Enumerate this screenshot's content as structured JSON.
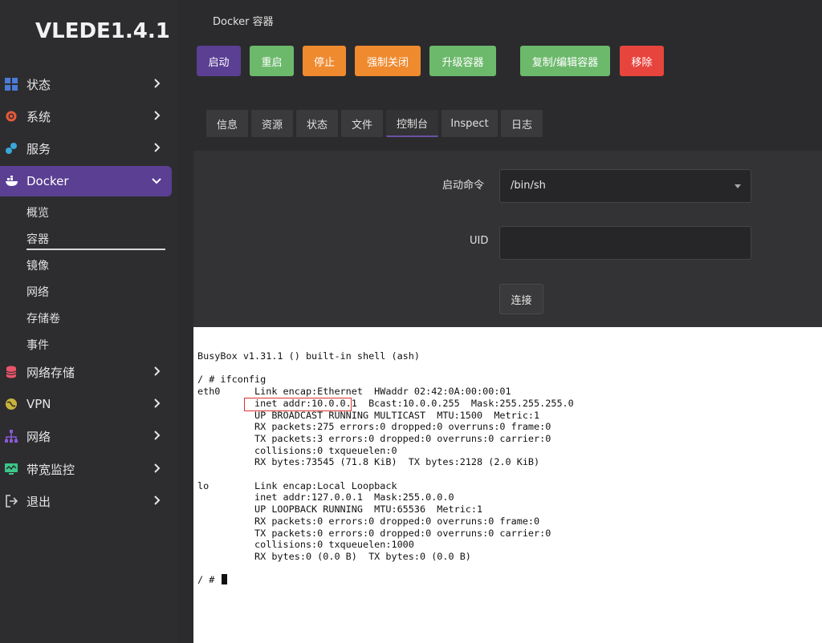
{
  "app": {
    "logo": "VLEDE1.4.1"
  },
  "sidebar": {
    "items": [
      {
        "label": "状态",
        "icon": "dashboard-icon",
        "color": "#4a7bd8"
      },
      {
        "label": "系统",
        "icon": "gear-icon",
        "color": "#e85a3a"
      },
      {
        "label": "服务",
        "icon": "services-icon",
        "color": "#3aa7d8"
      },
      {
        "label": "Docker",
        "icon": "docker-icon",
        "color": "#ffffff"
      },
      {
        "label": "网络存储",
        "icon": "storage-icon",
        "color": "#e8556a"
      },
      {
        "label": "VPN",
        "icon": "vpn-icon",
        "color": "#c8b43a"
      },
      {
        "label": "网络",
        "icon": "network-icon",
        "color": "#8a5ad8"
      },
      {
        "label": "带宽监控",
        "icon": "monitor-icon",
        "color": "#3ac88a"
      },
      {
        "label": "退出",
        "icon": "logout-icon",
        "color": "#cfcfcf"
      }
    ],
    "docker_sub": [
      "概览",
      "容器",
      "镜像",
      "网络",
      "存储卷",
      "事件"
    ]
  },
  "main": {
    "title": "Docker 容器",
    "buttons": {
      "start": "启动",
      "restart": "重启",
      "stop": "停止",
      "kill": "强制关闭",
      "upgrade": "升级容器",
      "duplicate": "复制/编辑容器",
      "remove": "移除"
    },
    "tabs": [
      "信息",
      "资源",
      "状态",
      "文件",
      "控制台",
      "Inspect",
      "日志"
    ],
    "form": {
      "command_label": "启动命令",
      "command_value": "/bin/sh",
      "uid_label": "UID",
      "uid_value": "",
      "connect": "连接"
    },
    "terminal": {
      "lines": [
        "BusyBox v1.31.1 () built-in shell (ash)",
        "",
        "/ # ifconfig",
        "eth0      Link encap:Ethernet  HWaddr 02:42:0A:00:00:01",
        "          inet addr:10.0.0.1  Bcast:10.0.0.255  Mask:255.255.255.0",
        "          UP BROADCAST RUNNING MULTICAST  MTU:1500  Metric:1",
        "          RX packets:275 errors:0 dropped:0 overruns:0 frame:0",
        "          TX packets:3 errors:0 dropped:0 overruns:0 carrier:0",
        "          collisions:0 txqueuelen:0",
        "          RX bytes:73545 (71.8 KiB)  TX bytes:2128 (2.0 KiB)",
        "",
        "lo        Link encap:Local Loopback",
        "          inet addr:127.0.0.1  Mask:255.0.0.0",
        "          UP LOOPBACK RUNNING  MTU:65536  Metric:1",
        "          RX packets:0 errors:0 dropped:0 overruns:0 frame:0",
        "          TX packets:0 errors:0 dropped:0 overruns:0 carrier:0",
        "          collisions:0 txqueuelen:1000",
        "          RX bytes:0 (0.0 B)  TX bytes:0 (0.0 B)",
        "",
        "/ # "
      ]
    }
  }
}
